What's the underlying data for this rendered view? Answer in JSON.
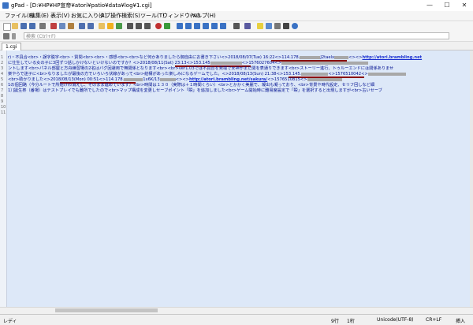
{
  "window": {
    "title": "gPad - [D:¥HP¥HP宣帝¥atori¥patio¥data¥log¥1.cgi]"
  },
  "menu": [
    "ファイル(F)",
    "編集(E)",
    "表示(V)",
    "お気に入り(A)",
    "タブ操作",
    "検索(S)",
    "ツール(T)",
    "ウィンドウ(W)",
    "ヘルプ(H)"
  ],
  "search": {
    "placeholder": "検索 (Ctrl+F)"
  },
  "tabs": [
    {
      "label": "1.cgi"
    }
  ],
  "editor": {
    "line_numbers": [
      "1",
      "2",
      "3",
      "4",
      "5",
      "6",
      "7",
      "8",
      "9",
      "10",
      "11"
    ],
    "lines": [
      {
        "a": "r)・不具合<br>・誤字脱字<br>・質問<br><br>・感想<br><br>など何かありましたら御自由にお書き下さい<>",
        "b": "2018/08/07(Tue) 16:22<>114.178.",
        "c": "J2taelx",
        "d": "<><>",
        "link": "http://atori.brambling.net",
        "e": ""
      },
      {
        "a": "に仕生している女の子に3回ずつ話しかけないといけないのですか？<>",
        "b": "2018/08/11(Sat) 23:13<>153.145",
        "c": "",
        "d": "<>1576027604<>",
        "link": "",
        "e": ""
      },
      {
        "a": "ントします<br>パネル部屋と方舟練習場の2名はバグ回避用で無関係となります<br><br>ver1.03では不具合を発端で女神がまだ関を表通りできます<br>ストーリー進行、トゥルーエンドには関係ありませ",
        "b": "",
        "c": "",
        "d": "",
        "link": "",
        "e": ""
      },
      {
        "a": "楽やらで迷子に<br>なりましたが最後の方でいろいろ伏線があって<br>結構があった楽しみになるゲームでした。<>",
        "b": "2018/08/13(Sun) 21:38<>153.145.",
        "c": "",
        "d": "<>1576510042<>",
        "link": "",
        "e": ""
      },
      {
        "a": "<br>助かりました<>",
        "b": "2018/08/13(Mon) 00:51<>114.178.",
        "c": "1x6K/13",
        "d": "<><>",
        "link": "http://atori.brambling.net/sakura/",
        "e": "<>1576510815<>"
      },
      {
        "a": "1の個回路（今分ルートで所始けわ消えし、そのまま進めています）<br>時間は１３０（実際は＋１時間くらい）<br>とかかく美麗で、凝出も凝っており、<br>背景や時代設定、セリフ回しなど細",
        "b": "",
        "c": "",
        "d": "",
        "link": "",
        "e": ""
      },
      {
        "a": "1）]誕生祭（番場）はテストプレイでも難所でしたので<br>マップ構成を変更しセーブポイント「瞬」を追加しました<br>ゲーム開始時に難易度設定で「瞬」を選択すると出現しますが<br>古いセーブ",
        "b": "",
        "c": "",
        "d": "",
        "link": "",
        "e": ""
      }
    ]
  },
  "status": {
    "mode": "レディ",
    "line": "9行",
    "col": "1桁",
    "encoding": "Unicode(UTF-8)",
    "eol": "CR+LF",
    "insert": "挿入"
  }
}
